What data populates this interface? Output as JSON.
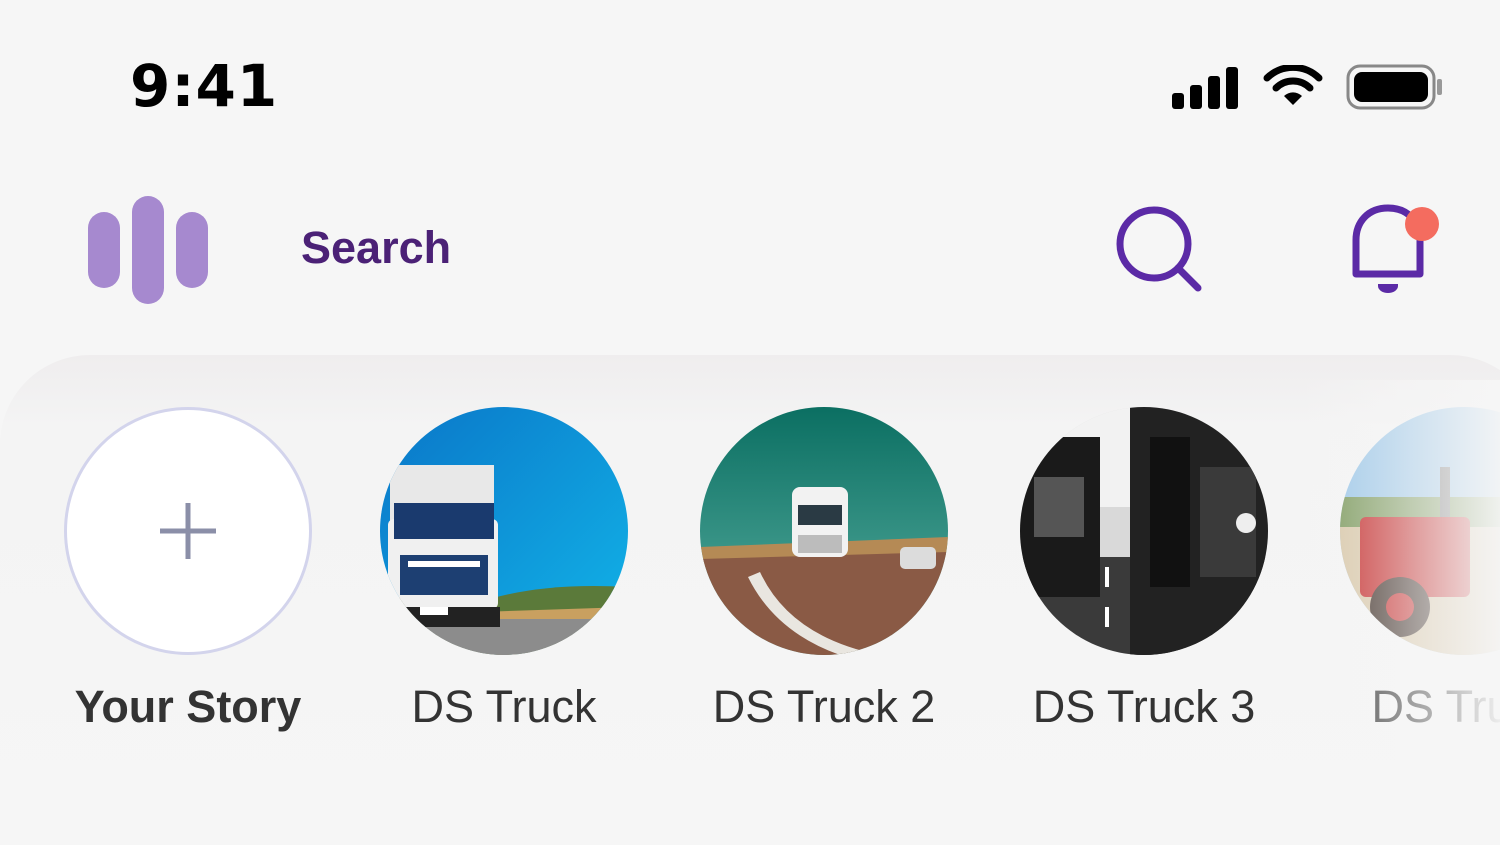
{
  "status_bar": {
    "time": "9:41",
    "icons": [
      "signal-icon",
      "wifi-icon",
      "battery-icon"
    ]
  },
  "header": {
    "logo_icon": "bars-logo-icon",
    "search_label": "Search",
    "actions": [
      "search-icon",
      "bell-icon"
    ],
    "notification_dot_color": "#f46c5f"
  },
  "stories": {
    "add_label": "Your Story",
    "items": [
      {
        "label": "DS Truck",
        "thumbnail": "blue truck on highway"
      },
      {
        "label": "DS Truck 2",
        "thumbnail": "white truck on road"
      },
      {
        "label": "DS Truck 3",
        "thumbnail": "trucks in traffic, black and white"
      },
      {
        "label": "DS Truck",
        "thumbnail": "red tractor"
      }
    ]
  },
  "colors": {
    "accent": "#5b2aa6",
    "logo": "#a689cf",
    "title": "#4b2176",
    "background": "#f6f6f6"
  }
}
